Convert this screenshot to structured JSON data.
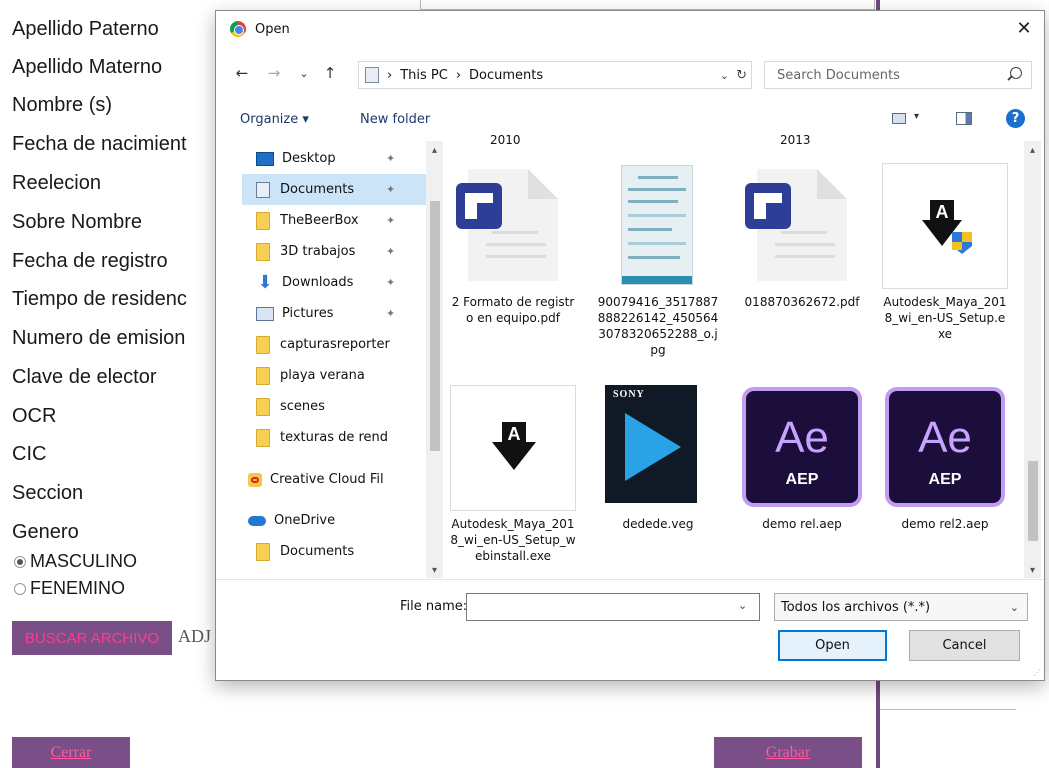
{
  "form": {
    "labels": [
      "Apellido Paterno",
      "Apellido Materno",
      "Nombre (s)",
      "Fecha de nacimient",
      "Reelecion",
      "Sobre Nombre",
      "Fecha de registro",
      "Tiempo de residenc",
      "Numero de emision",
      "Clave de elector",
      "OCR",
      "CIC",
      "Seccion",
      "Genero"
    ],
    "radio_masculino": "MASCULINO",
    "radio_femenino": "FENEMINO",
    "selected_gender": "MASCULINO",
    "buscar_button": "BUSCAR ARCHIVO",
    "adj_text": "ADJ",
    "cerrar_button": "Cerrar",
    "grabar_button": "Grabar"
  },
  "dialog": {
    "title": "Open",
    "close_glyph": "✕",
    "nav": {
      "back": "←",
      "forward": "→",
      "recent": "⌄",
      "up": "↑"
    },
    "path": [
      "This PC",
      "Documents"
    ],
    "path_separator": "›",
    "search_placeholder": "Search Documents",
    "toolbar": {
      "organize": "Organize ▾",
      "new_folder": "New folder",
      "help": "?"
    },
    "sidebar": [
      {
        "label": "Desktop",
        "icon": "desktop-icon",
        "pinned": true
      },
      {
        "label": "Documents",
        "icon": "documents-icon",
        "pinned": true,
        "selected": true
      },
      {
        "label": "TheBeerBox",
        "icon": "folder-icon",
        "pinned": true
      },
      {
        "label": "3D trabajos",
        "icon": "folder-icon",
        "pinned": true
      },
      {
        "label": "Downloads",
        "icon": "downloads-icon",
        "pinned": true
      },
      {
        "label": "Pictures",
        "icon": "pictures-icon",
        "pinned": true
      },
      {
        "label": "capturasreporter",
        "icon": "folder-icon"
      },
      {
        "label": "playa verana",
        "icon": "folder-icon"
      },
      {
        "label": "scenes",
        "icon": "folder-icon"
      },
      {
        "label": "texturas de rend",
        "icon": "folder-icon"
      },
      {
        "label": "Creative Cloud Fil",
        "icon": "creative-cloud-icon"
      },
      {
        "label": "OneDrive",
        "icon": "onedrive-icon"
      },
      {
        "label": "Documents",
        "icon": "folder-icon"
      }
    ],
    "pin_glyph": "📌",
    "partial_labels": [
      "2010",
      "2013"
    ],
    "files": [
      {
        "name": "2 Formato de registro en equipo.pdf",
        "kind": "docs"
      },
      {
        "name": "90079416_3517887888226142_4505643078320652288_o.jpg",
        "kind": "jpg"
      },
      {
        "name": "018870362672.pdf",
        "kind": "docs"
      },
      {
        "name": "Autodesk_Maya_2018_wi_en-US_Setup.exe",
        "kind": "installer-shield"
      },
      {
        "name": "Autodesk_Maya_2018_wi_en-US_Setup_webinstall.exe",
        "kind": "installer"
      },
      {
        "name": "dedede.veg",
        "kind": "veg"
      },
      {
        "name": "demo rel.aep",
        "kind": "aep"
      },
      {
        "name": "demo rel2.aep",
        "kind": "aep"
      }
    ],
    "aep": {
      "big": "Ae",
      "small": "AEP"
    },
    "sony": "SONY",
    "file_name_label": "File name:",
    "file_name_value": "",
    "file_type": "Todos los archivos (*.*)",
    "open_button": "Open",
    "cancel_button": "Cancel",
    "colors": {
      "accent": "#0078d7",
      "selection": "#cce4f7",
      "form_button": "#7a4e86",
      "form_button_text": "#ff3c8e"
    }
  }
}
